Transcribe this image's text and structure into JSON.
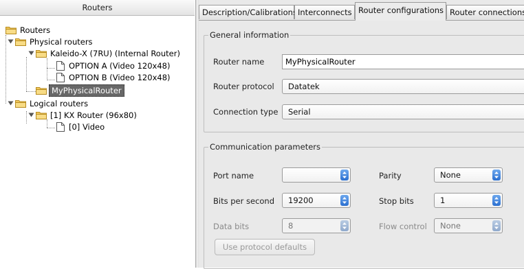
{
  "tree": {
    "header": "Routers",
    "root": "Routers",
    "physical": "Physical routers",
    "kaleido": "Kaleido-X (7RU) (Internal Router)",
    "option_a": "OPTION A (Video 120x48)",
    "option_b": "OPTION B (Video 120x48)",
    "my_physical": "MyPhysicalRouter",
    "logical": "Logical routers",
    "kx_router": "[1] KX Router (96x80)",
    "video": "[0] Video"
  },
  "tabs": [
    "Description/Calibrations",
    "Interconnects",
    "Router configurations",
    "Router connections"
  ],
  "general": {
    "title": "General information",
    "router_name_label": "Router name",
    "router_name_value": "MyPhysicalRouter",
    "protocol_label": "Router protocol",
    "protocol_value": "Datatek",
    "connection_label": "Connection type",
    "connection_value": "Serial"
  },
  "comm": {
    "title": "Communication parameters",
    "port_name_label": "Port name",
    "port_name_value": "",
    "parity_label": "Parity",
    "parity_value": "None",
    "bits_label": "Bits per second",
    "bits_value": "19200",
    "stop_bits_label": "Stop bits",
    "stop_bits_value": "1",
    "data_bits_label": "Data bits",
    "data_bits_value": "8",
    "flow_label": "Flow control",
    "flow_value": "None",
    "defaults_button": "Use protocol defaults"
  },
  "colors": {
    "folder": "#f2c95c",
    "selection": "#686868",
    "spinner": "#3a7bd8"
  }
}
